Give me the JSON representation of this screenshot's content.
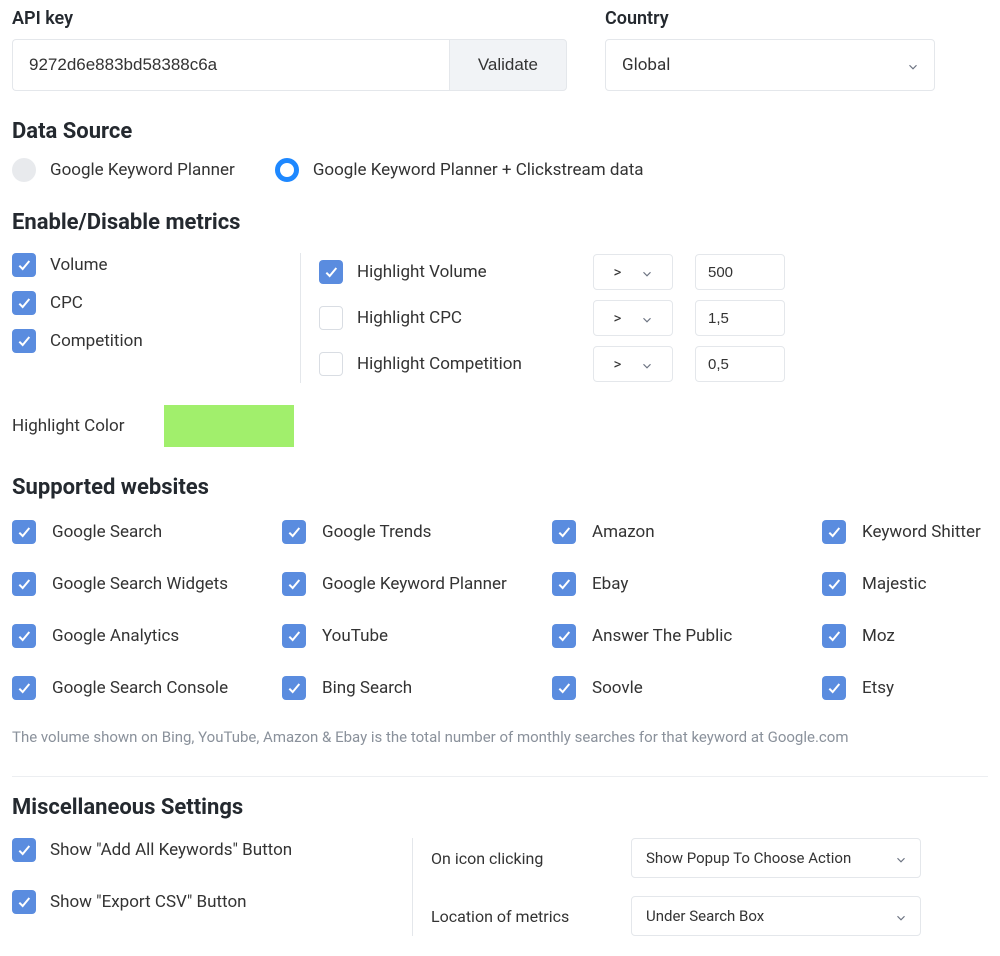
{
  "api": {
    "label": "API key",
    "value": "9272d6e883bd58388c6a",
    "validate_label": "Validate"
  },
  "country": {
    "label": "Country",
    "value": "Global"
  },
  "data_source": {
    "label": "Data Source",
    "options": [
      {
        "label": "Google Keyword Planner",
        "selected": false
      },
      {
        "label": "Google Keyword Planner + Clickstream data",
        "selected": true
      }
    ]
  },
  "metrics": {
    "label": "Enable/Disable metrics",
    "left": [
      {
        "label": "Volume",
        "checked": true
      },
      {
        "label": "CPC",
        "checked": true
      },
      {
        "label": "Competition",
        "checked": true
      }
    ],
    "right": [
      {
        "label": "Highlight Volume",
        "checked": true,
        "op": ">",
        "value": "500"
      },
      {
        "label": "Highlight CPC",
        "checked": false,
        "op": ">",
        "value": "1,5"
      },
      {
        "label": "Highlight Competition",
        "checked": false,
        "op": ">",
        "value": "0,5"
      }
    ],
    "highlight_color_label": "Highlight Color",
    "highlight_color": "#a1ef6c"
  },
  "supported": {
    "label": "Supported websites",
    "sites": [
      "Google Search",
      "Google Trends",
      "Amazon",
      "Keyword Shitter",
      "Google Search Widgets",
      "Google Keyword Planner",
      "Ebay",
      "Majestic",
      "Google Analytics",
      "YouTube",
      "Answer The Public",
      "Moz",
      "Google Search Console",
      "Bing Search",
      "Soovle",
      "Etsy"
    ],
    "note": "The volume shown on Bing, YouTube, Amazon & Ebay is the total number of monthly searches for that keyword at Google.com"
  },
  "misc": {
    "label": "Miscellaneous Settings",
    "left": [
      {
        "label": "Show \"Add All Keywords\" Button",
        "checked": true
      },
      {
        "label": "Show \"Export CSV\" Button",
        "checked": true
      }
    ],
    "right": [
      {
        "label": "On icon clicking",
        "value": "Show Popup To Choose Action"
      },
      {
        "label": "Location of metrics",
        "value": "Under Search Box"
      }
    ]
  }
}
